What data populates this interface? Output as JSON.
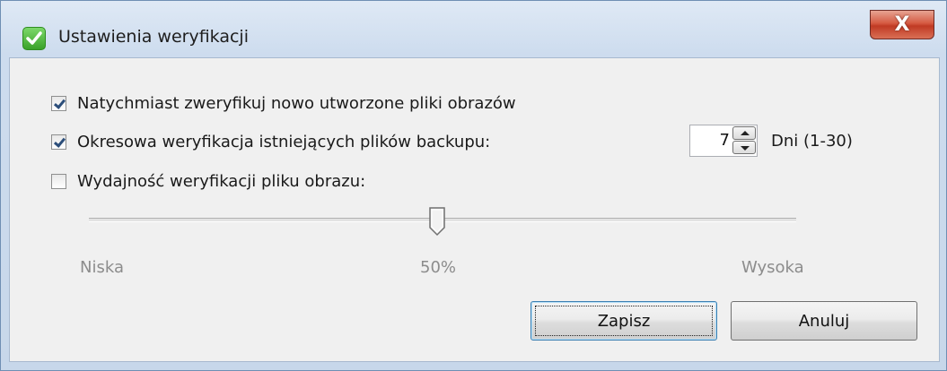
{
  "window": {
    "title": "Ustawienia weryfikacji",
    "close_label": "X"
  },
  "options": {
    "verify_new_label": "Natychmiast zweryfikuj nowo utworzone pliki obrazów",
    "verify_new_checked": true,
    "periodic_label": "Okresowa weryfikacja istniejących plików backupu:",
    "periodic_checked": true,
    "periodic_days": "7",
    "periodic_unit": "Dni (1-30)",
    "performance_label": "Wydajność weryfikacji pliku obrazu:",
    "performance_checked": false
  },
  "slider": {
    "value_percent": 50,
    "low_label": "Niska",
    "mid_label": "50%",
    "high_label": "Wysoka"
  },
  "buttons": {
    "save_label": "Zapisz",
    "cancel_label": "Anuluj"
  },
  "colors": {
    "accent_green": "#3aa229",
    "close_red": "#c03a24",
    "frame_blue": "#cddcee"
  },
  "icons": {
    "app": "green-check-shield-icon",
    "close": "close-icon",
    "spin_up": "arrow-up-icon",
    "spin_down": "arrow-down-icon"
  }
}
